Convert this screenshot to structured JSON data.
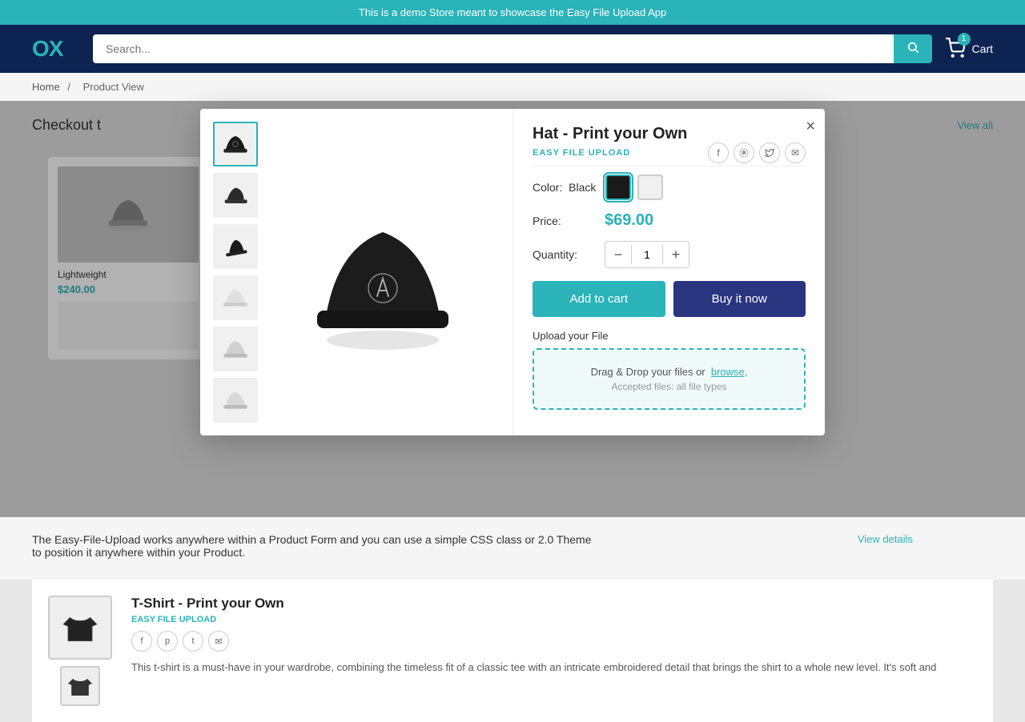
{
  "banner": {
    "text": "This is a demo Store meant to showcase the Easy File Upload App"
  },
  "header": {
    "logo": "OX",
    "search_placeholder": "Search...",
    "cart_label": "Cart",
    "cart_count": "1"
  },
  "breadcrumb": {
    "home": "Home",
    "current": "Product View"
  },
  "page": {
    "section_title": "Checkout t",
    "view_all": "View all"
  },
  "bg_product": {
    "name": "Lightweight",
    "price": "$240.00"
  },
  "modal": {
    "title": "Hat - Print your Own",
    "easy_label": "EASY FILE UPLOAD",
    "close_label": "×",
    "color_label": "Color:",
    "color_value": "Black",
    "price_label": "Price:",
    "price_value": "$69.00",
    "quantity_label": "Quantity:",
    "quantity_value": "1",
    "add_to_cart": "Add to cart",
    "buy_now": "Buy it now",
    "upload_label": "Upload your File",
    "upload_text": "Drag & Drop your files or",
    "upload_link": "browse",
    "upload_hint": "Accepted files: all file types"
  },
  "below": {
    "desc": "The Easy-File-Upload works anywhere within a Product Form and you can use a simple CSS class or 2.0 Theme to position it anywhere within your Product.",
    "view_details": "View details"
  },
  "second_product": {
    "title": "T-Shirt - Print your Own",
    "easy_label": "EASY FILE UPLOAD",
    "desc": "This t-shirt is a must-have in your wardrobe, combining the timeless fit of a classic tee with an intricate embroidered detail that brings the shirt to a whole new level. It's soft and"
  },
  "social_icons": [
    {
      "name": "facebook",
      "symbol": "f"
    },
    {
      "name": "pinterest",
      "symbol": "p"
    },
    {
      "name": "twitter",
      "symbol": "t"
    },
    {
      "name": "email",
      "symbol": "✉"
    }
  ]
}
